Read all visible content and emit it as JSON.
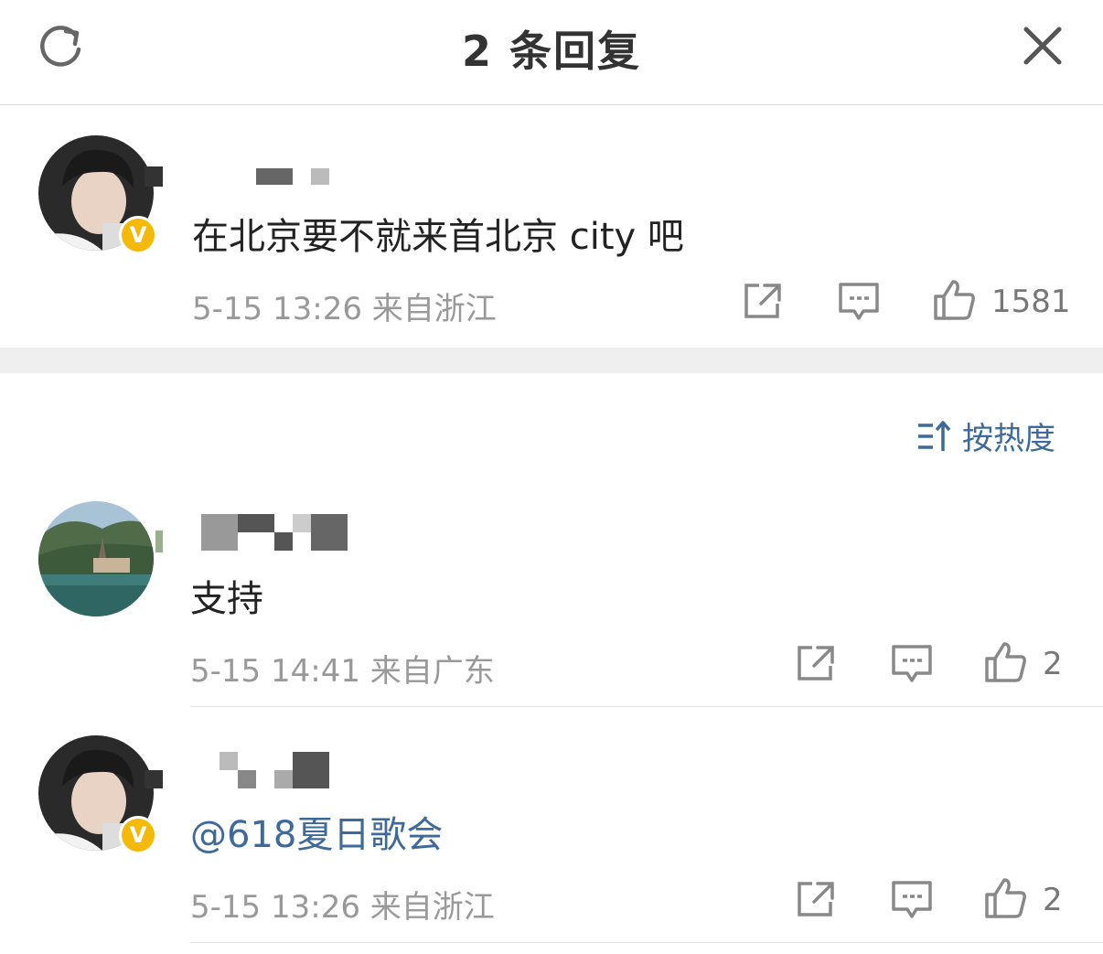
{
  "header": {
    "title": "2 条回复",
    "refresh_icon": "refresh-icon",
    "close_icon": "close-icon"
  },
  "root_comment": {
    "text": "在北京要不就来首北京 city 吧",
    "time": "5-15 13:26",
    "location": "来自浙江",
    "likes": "1581",
    "verified_badge": "V"
  },
  "sort": {
    "label": "按热度",
    "icon": "sort-icon"
  },
  "replies": [
    {
      "text": "支持",
      "time": "5-15 14:41",
      "location": "来自广东",
      "likes": "2"
    },
    {
      "mention": "@618夏日歌会",
      "time": "5-15 13:26",
      "location": "来自浙江",
      "likes": "2",
      "verified_badge": "V"
    }
  ],
  "colors": {
    "accent_link": "#3e6a9b",
    "badge": "#f5b90a",
    "meta_text": "#999999"
  }
}
